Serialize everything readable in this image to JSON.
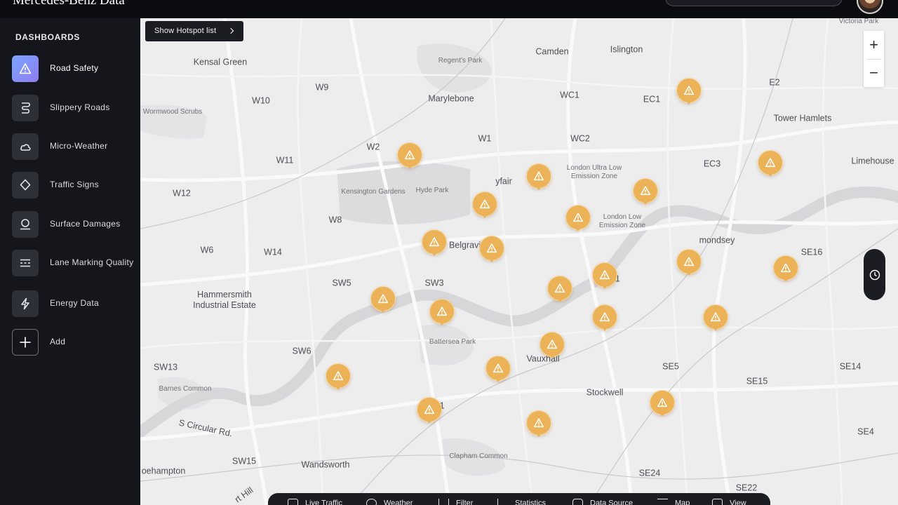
{
  "header": {
    "app_title": "Mercedes-Benz Data"
  },
  "sidebar": {
    "heading": "DASHBOARDS",
    "items": [
      {
        "label": "Road Safety",
        "icon": "warning-icon",
        "active": true
      },
      {
        "label": "Slippery Roads",
        "icon": "slippery-road-icon",
        "active": false
      },
      {
        "label": "Micro-Weather",
        "icon": "cloud-icon",
        "active": false
      },
      {
        "label": "Traffic Signs",
        "icon": "diamond-sign-icon",
        "active": false
      },
      {
        "label": "Surface Damages",
        "icon": "pothole-icon",
        "active": false
      },
      {
        "label": "Lane Marking Quality",
        "icon": "lane-marking-icon",
        "active": false
      },
      {
        "label": "Energy Data",
        "icon": "lightning-icon",
        "active": false
      },
      {
        "label": "Add",
        "icon": "plus-icon",
        "active": false
      }
    ]
  },
  "map": {
    "hotspot_button": "Show Hotspot list",
    "zoom_in": "+",
    "zoom_out": "−",
    "labels": [
      "Victoria Park",
      "Kensal Green",
      "Regent's Park",
      "Camden",
      "Islington",
      "E2",
      "W9",
      "W10",
      "Marylebone",
      "WC1",
      "EC1",
      "Tower Hamlets",
      "Wormwood Scrubs",
      "W2",
      "W1",
      "WC2",
      "EC3",
      "Limehouse",
      "W11",
      "London Ultra Low Emission Zone",
      "Kensington Gardens",
      "Hyde Park",
      "yfair",
      "W12",
      "W8",
      "London Low Emission Zone",
      "Belgravia",
      "W6",
      "W14",
      "mondsey",
      "SE16",
      "Hammersmith Industrial Estate",
      "SW5",
      "SW3",
      "SE11",
      "SW6",
      "Battersea Park",
      "Vauxhall",
      "SE5",
      "SE14",
      "SW13",
      "Barnes Common",
      "SE15",
      "SW11",
      "Stockwell",
      "S Circular Rd.",
      "SE4",
      "SW15",
      "Wandsworth",
      "Clapham Common",
      "oehampton",
      "SE24",
      "SE22",
      "rt Hill"
    ],
    "hotspot_count": 24
  },
  "bottom_bar": {
    "items": [
      "Live Traffic",
      "Weather",
      "Filter",
      "Statistics",
      "Data Source",
      "Map",
      "View"
    ]
  }
}
